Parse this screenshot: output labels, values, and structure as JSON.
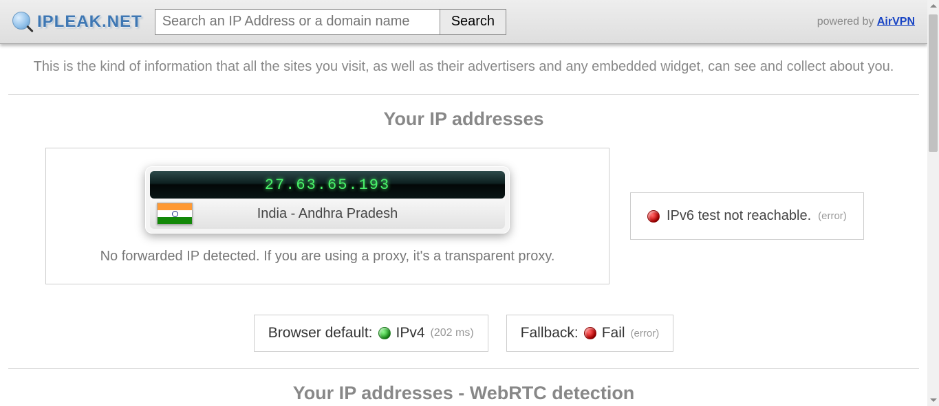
{
  "header": {
    "logo_text": "IPLEAK.NET",
    "search_placeholder": "Search an IP Address or a domain name",
    "search_button": "Search",
    "powered_prefix": "powered by ",
    "powered_link": "AirVPN"
  },
  "intro": "This is the kind of information that all the sites you visit, as well as their advertisers and any embedded widget, can see and collect about you.",
  "sections": {
    "ip_heading": "Your IP addresses",
    "webrtc_heading": "Your IP addresses - WebRTC detection"
  },
  "ip": {
    "address": "27.63.65.193",
    "location": "India - Andhra Pradesh",
    "proxy_note": "No forwarded IP detected. If you are using a proxy, it's a transparent proxy."
  },
  "ipv6": {
    "status": "IPv6 test not reachable.",
    "suffix": "(error)"
  },
  "browser_default": {
    "label": "Browser default:",
    "value": "IPv4",
    "ms": "(202 ms)"
  },
  "fallback": {
    "label": "Fallback:",
    "value": "Fail",
    "suffix": "(error)"
  }
}
